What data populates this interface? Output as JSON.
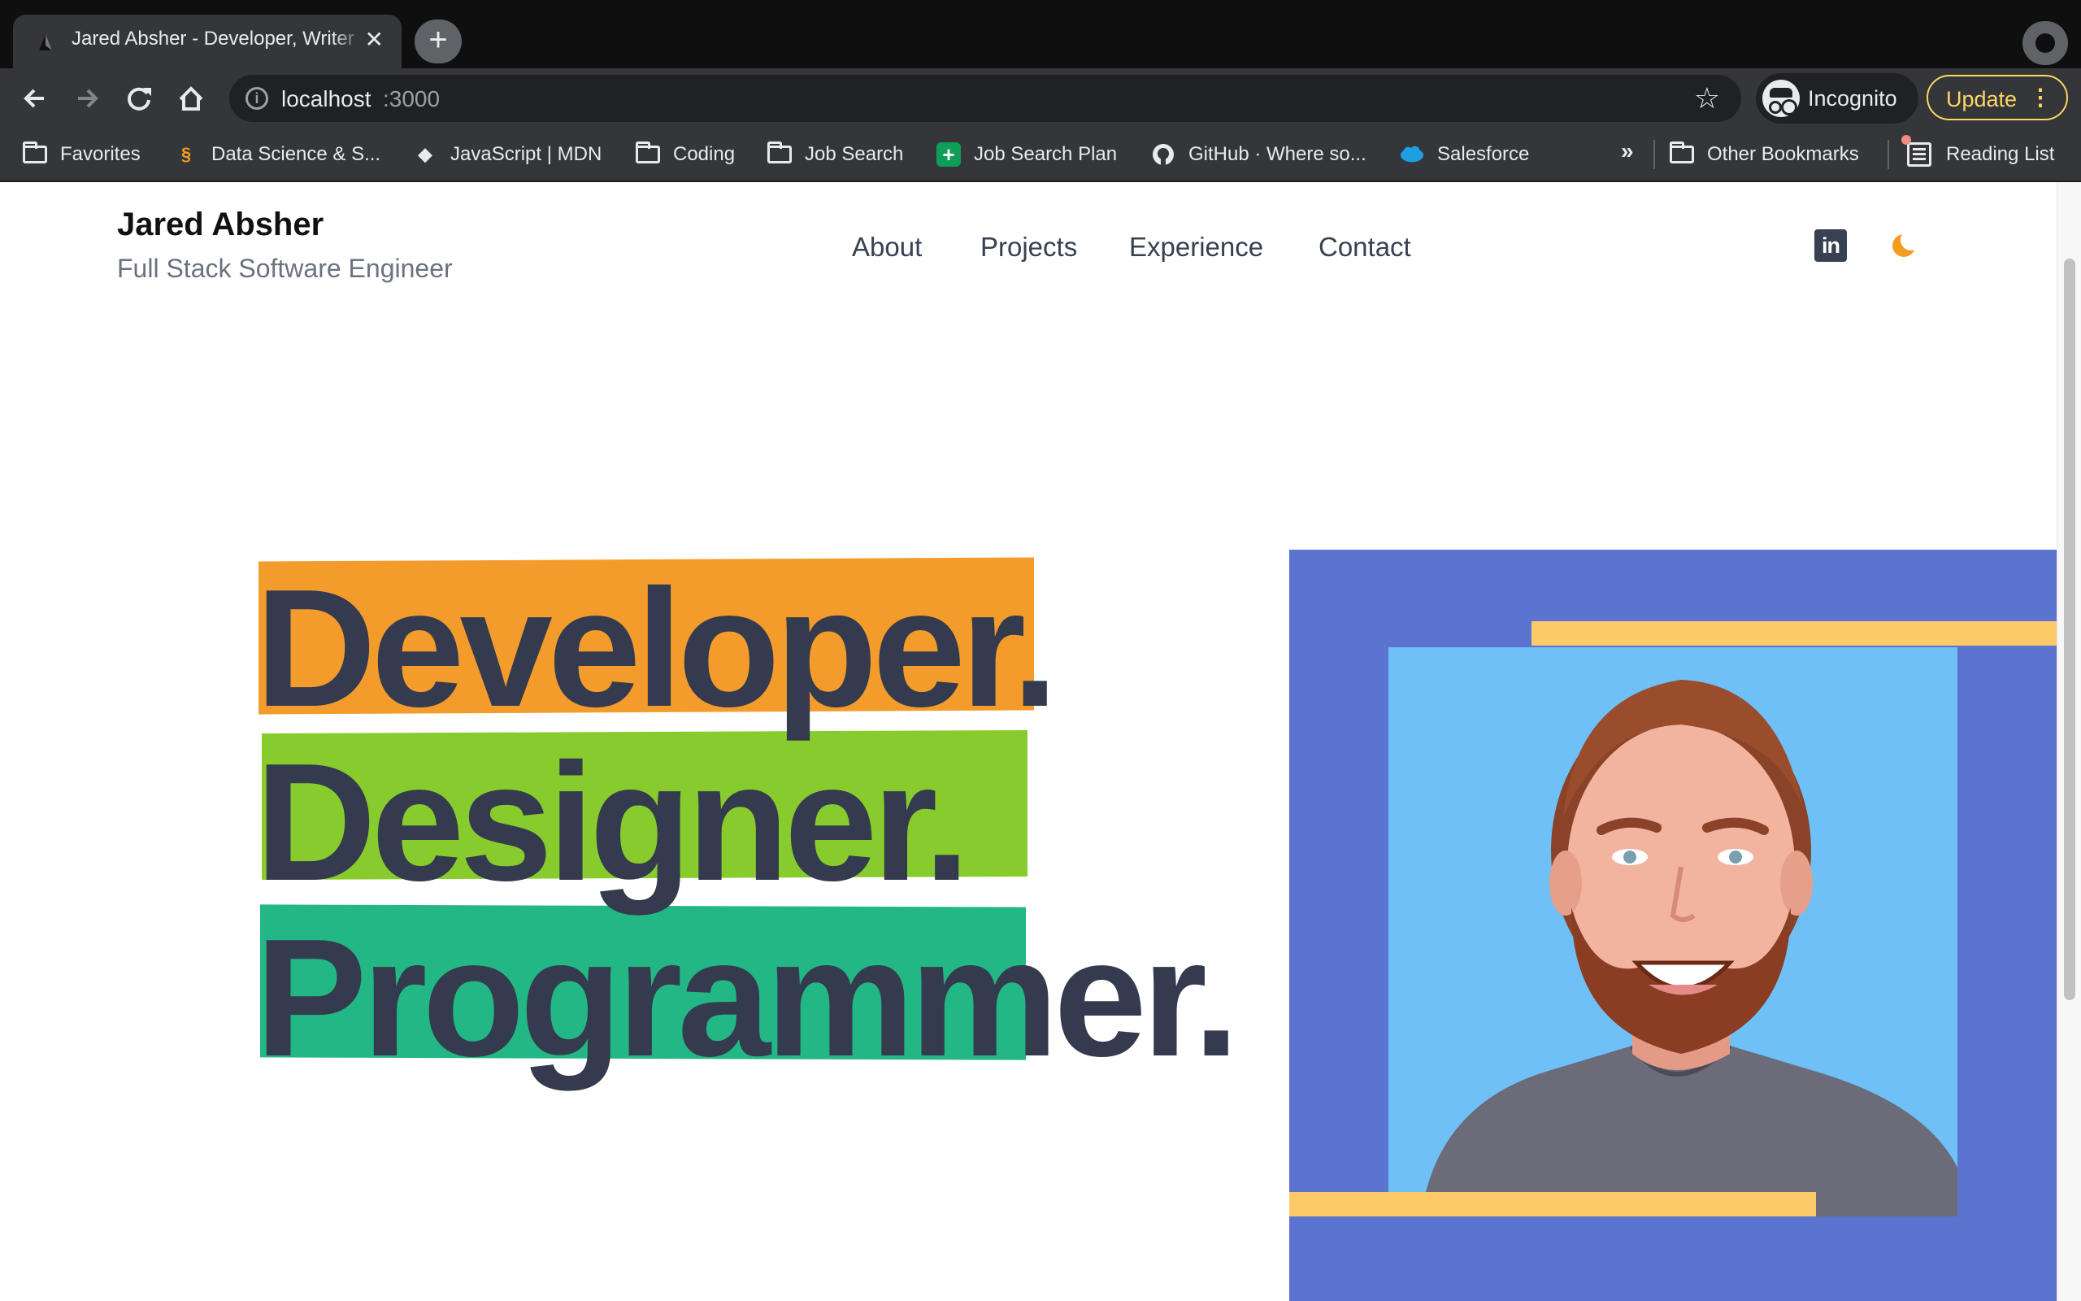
{
  "browser": {
    "tab": {
      "title": "Jared Absher - Developer, Writer",
      "close": "✕"
    },
    "new_tab": "+",
    "omnibox": {
      "host": "localhost",
      "port": ":3000"
    },
    "incognito_label": "Incognito",
    "update_label": "Update",
    "bookmarks": [
      {
        "label": "Favorites",
        "icon": "folder-icon"
      },
      {
        "label": "Data Science & S...",
        "icon": "data-science-icon"
      },
      {
        "label": "JavaScript | MDN",
        "icon": "mdn-icon"
      },
      {
        "label": "Coding",
        "icon": "folder-icon"
      },
      {
        "label": "Job Search",
        "icon": "folder-icon"
      },
      {
        "label": "Job Search Plan",
        "icon": "sheets-icon"
      },
      {
        "label": "GitHub · Where so...",
        "icon": "github-icon"
      },
      {
        "label": "Salesforce",
        "icon": "salesforce-icon"
      }
    ],
    "bookmarks_more": "»",
    "other_bookmarks": "Other Bookmarks",
    "reading_list": "Reading List"
  },
  "site": {
    "name": "Jared Absher",
    "subtitle": "Full Stack Software Engineer",
    "nav": [
      "About",
      "Projects",
      "Experience",
      "Contact"
    ],
    "linkedin_glyph": "in",
    "hero_words": [
      "Developer.",
      "Designer.",
      "Programmer."
    ]
  },
  "colors": {
    "orange_highlight": "#f39c2b",
    "green_highlight": "#88cb2d",
    "teal_highlight": "#22b784",
    "hero_text": "#343b4e",
    "portrait_frame": "#5b74d0",
    "portrait_bg": "#6ec0f6",
    "accent_bars": "#fdc969",
    "dark_mode_toggle": "#f39c1f"
  }
}
